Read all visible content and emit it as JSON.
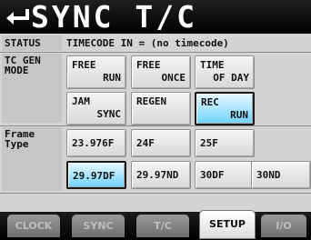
{
  "title": "SYNC T/C",
  "status": {
    "label": "STATUS",
    "value": "TIMECODE IN = (no timecode)"
  },
  "tc_gen_mode": {
    "label": "TC GEN\nMODE",
    "buttons": [
      {
        "line1": "FREE",
        "line2": "RUN",
        "selected": false
      },
      {
        "line1": "FREE",
        "line2": "ONCE",
        "selected": false
      },
      {
        "line1": "TIME",
        "line2": "OF DAY",
        "selected": false
      },
      {
        "line1": "JAM",
        "line2": "SYNC",
        "selected": false
      },
      {
        "line1": "REGEN",
        "line2": "",
        "selected": false
      },
      {
        "line1": "REC",
        "line2": "RUN",
        "selected": true
      }
    ]
  },
  "frame_type": {
    "label": "Frame\nType",
    "buttons": [
      {
        "label": "23.976F",
        "selected": false
      },
      {
        "label": "24F",
        "selected": false
      },
      {
        "label": "25F",
        "selected": false
      },
      {
        "label": "29.97DF",
        "selected": true
      },
      {
        "label": "29.97ND",
        "selected": false
      },
      {
        "label": "30DF",
        "selected": false
      },
      {
        "label": "30ND",
        "selected": false
      }
    ]
  },
  "tabs": [
    {
      "label": "CLOCK",
      "active": false
    },
    {
      "label": "SYNC",
      "active": false
    },
    {
      "label": "T/C",
      "active": false
    },
    {
      "label": "SETUP",
      "active": true
    },
    {
      "label": "I/O",
      "active": false
    }
  ],
  "colors": {
    "selected": "#6ed2ff",
    "title_bg": "#000000",
    "panel": "#d4d4d4"
  },
  "icons": {
    "back": "return-arrow-icon"
  }
}
